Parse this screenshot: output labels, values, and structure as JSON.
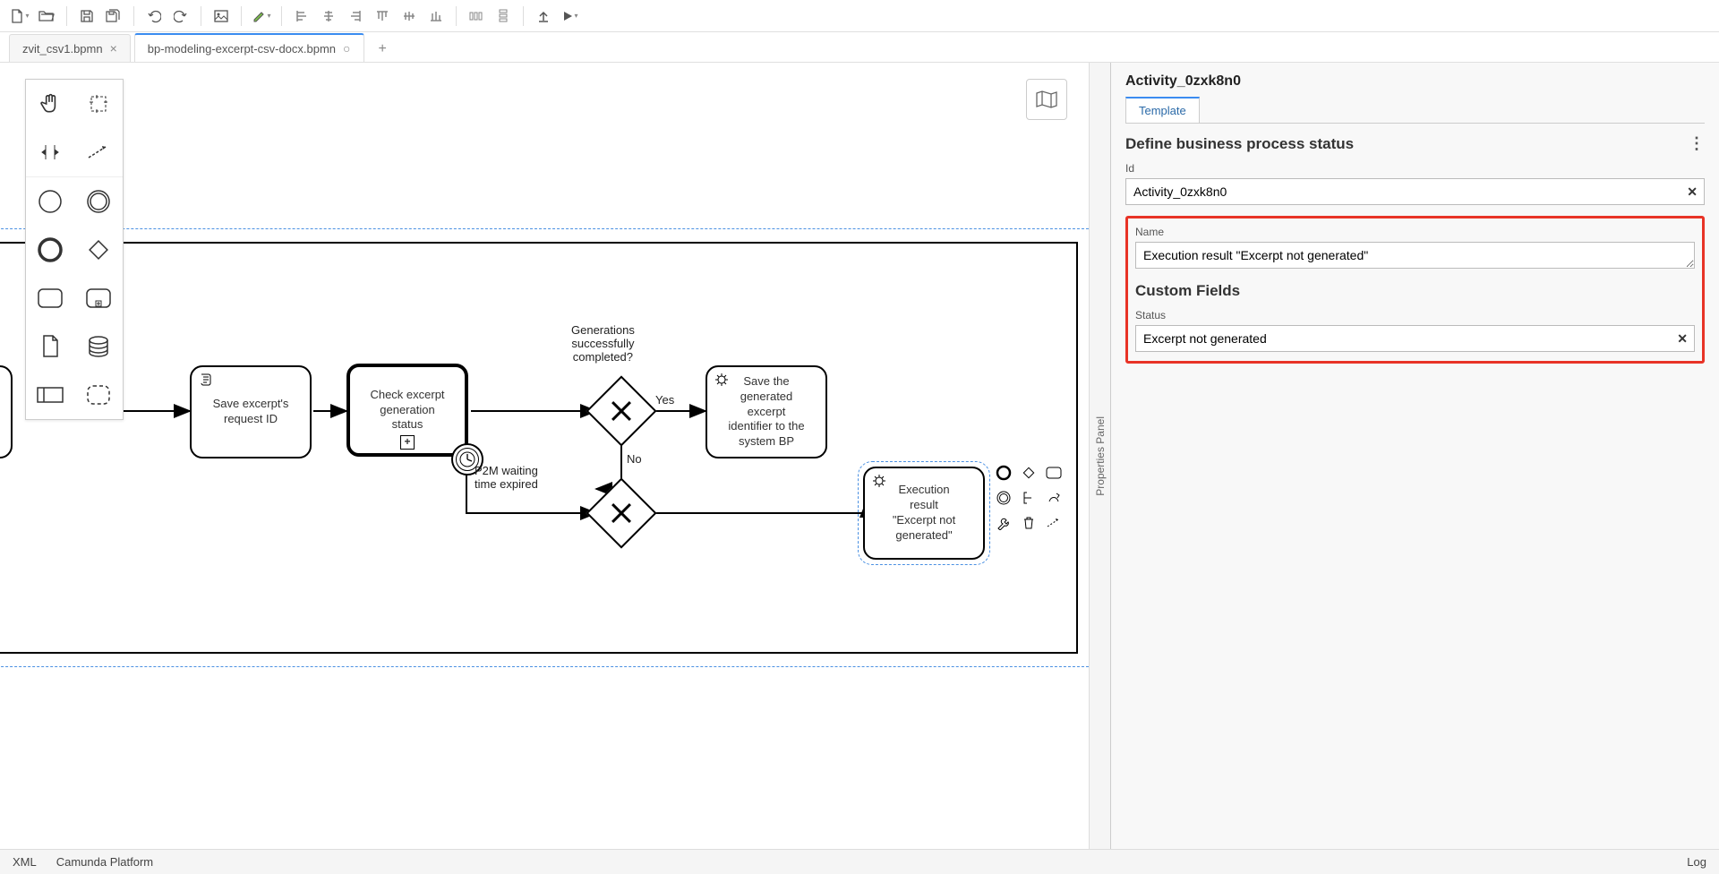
{
  "tabs": [
    {
      "label": "zvit_csv1.bpmn",
      "close": "×",
      "active": false
    },
    {
      "label": "bp-modeling-excerpt-csv-docx.bpmn",
      "dirty": "○",
      "active": true
    }
  ],
  "diagram": {
    "save_excerpt": "Save excerpt's\nrequest ID",
    "check_status": "Check excerpt\ngeneration\nstatus",
    "gw_label": "Generations\nsuccessfully\ncompleted?",
    "yes": "Yes",
    "no": "No",
    "timer_label": "P2M waiting\ntime expired",
    "save_generated": "Save the\ngenerated\nexcerpt\nidentifier to the\nsystem BP",
    "exec_result": "Execution\nresult\n\"Excerpt not\ngenerated\""
  },
  "props": {
    "title": "Activity_0zxk8n0",
    "tab": "Template",
    "group1": "Define business process status",
    "id_label": "Id",
    "id_value": "Activity_0zxk8n0",
    "name_label": "Name",
    "name_value": "Execution result \"Excerpt not generated\"",
    "custom_header": "Custom Fields",
    "status_label": "Status",
    "status_value": "Excerpt not generated"
  },
  "panel_toggle": "Properties Panel",
  "status_bar": {
    "xml": "XML",
    "platform": "Camunda Platform",
    "log": "Log"
  }
}
